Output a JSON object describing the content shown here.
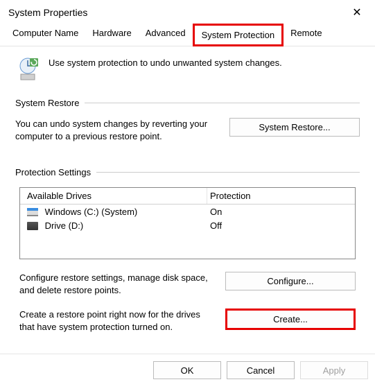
{
  "title": "System Properties",
  "tabs": {
    "computer_name": "Computer Name",
    "hardware": "Hardware",
    "advanced": "Advanced",
    "system_protection": "System Protection",
    "remote": "Remote"
  },
  "intro_text": "Use system protection to undo unwanted system changes.",
  "restore": {
    "header": "System Restore",
    "desc": "You can undo system changes by reverting your computer to a previous restore point.",
    "button": "System Restore..."
  },
  "protection": {
    "header": "Protection Settings",
    "col_drive": "Available Drives",
    "col_prot": "Protection",
    "drives": [
      {
        "name": "Windows (C:) (System)",
        "status": "On"
      },
      {
        "name": "Drive (D:)",
        "status": "Off"
      }
    ],
    "configure_text": "Configure restore settings, manage disk space, and delete restore points.",
    "configure_btn": "Configure...",
    "create_text": "Create a restore point right now for the drives that have system protection turned on.",
    "create_btn": "Create..."
  },
  "buttons": {
    "ok": "OK",
    "cancel": "Cancel",
    "apply": "Apply"
  }
}
